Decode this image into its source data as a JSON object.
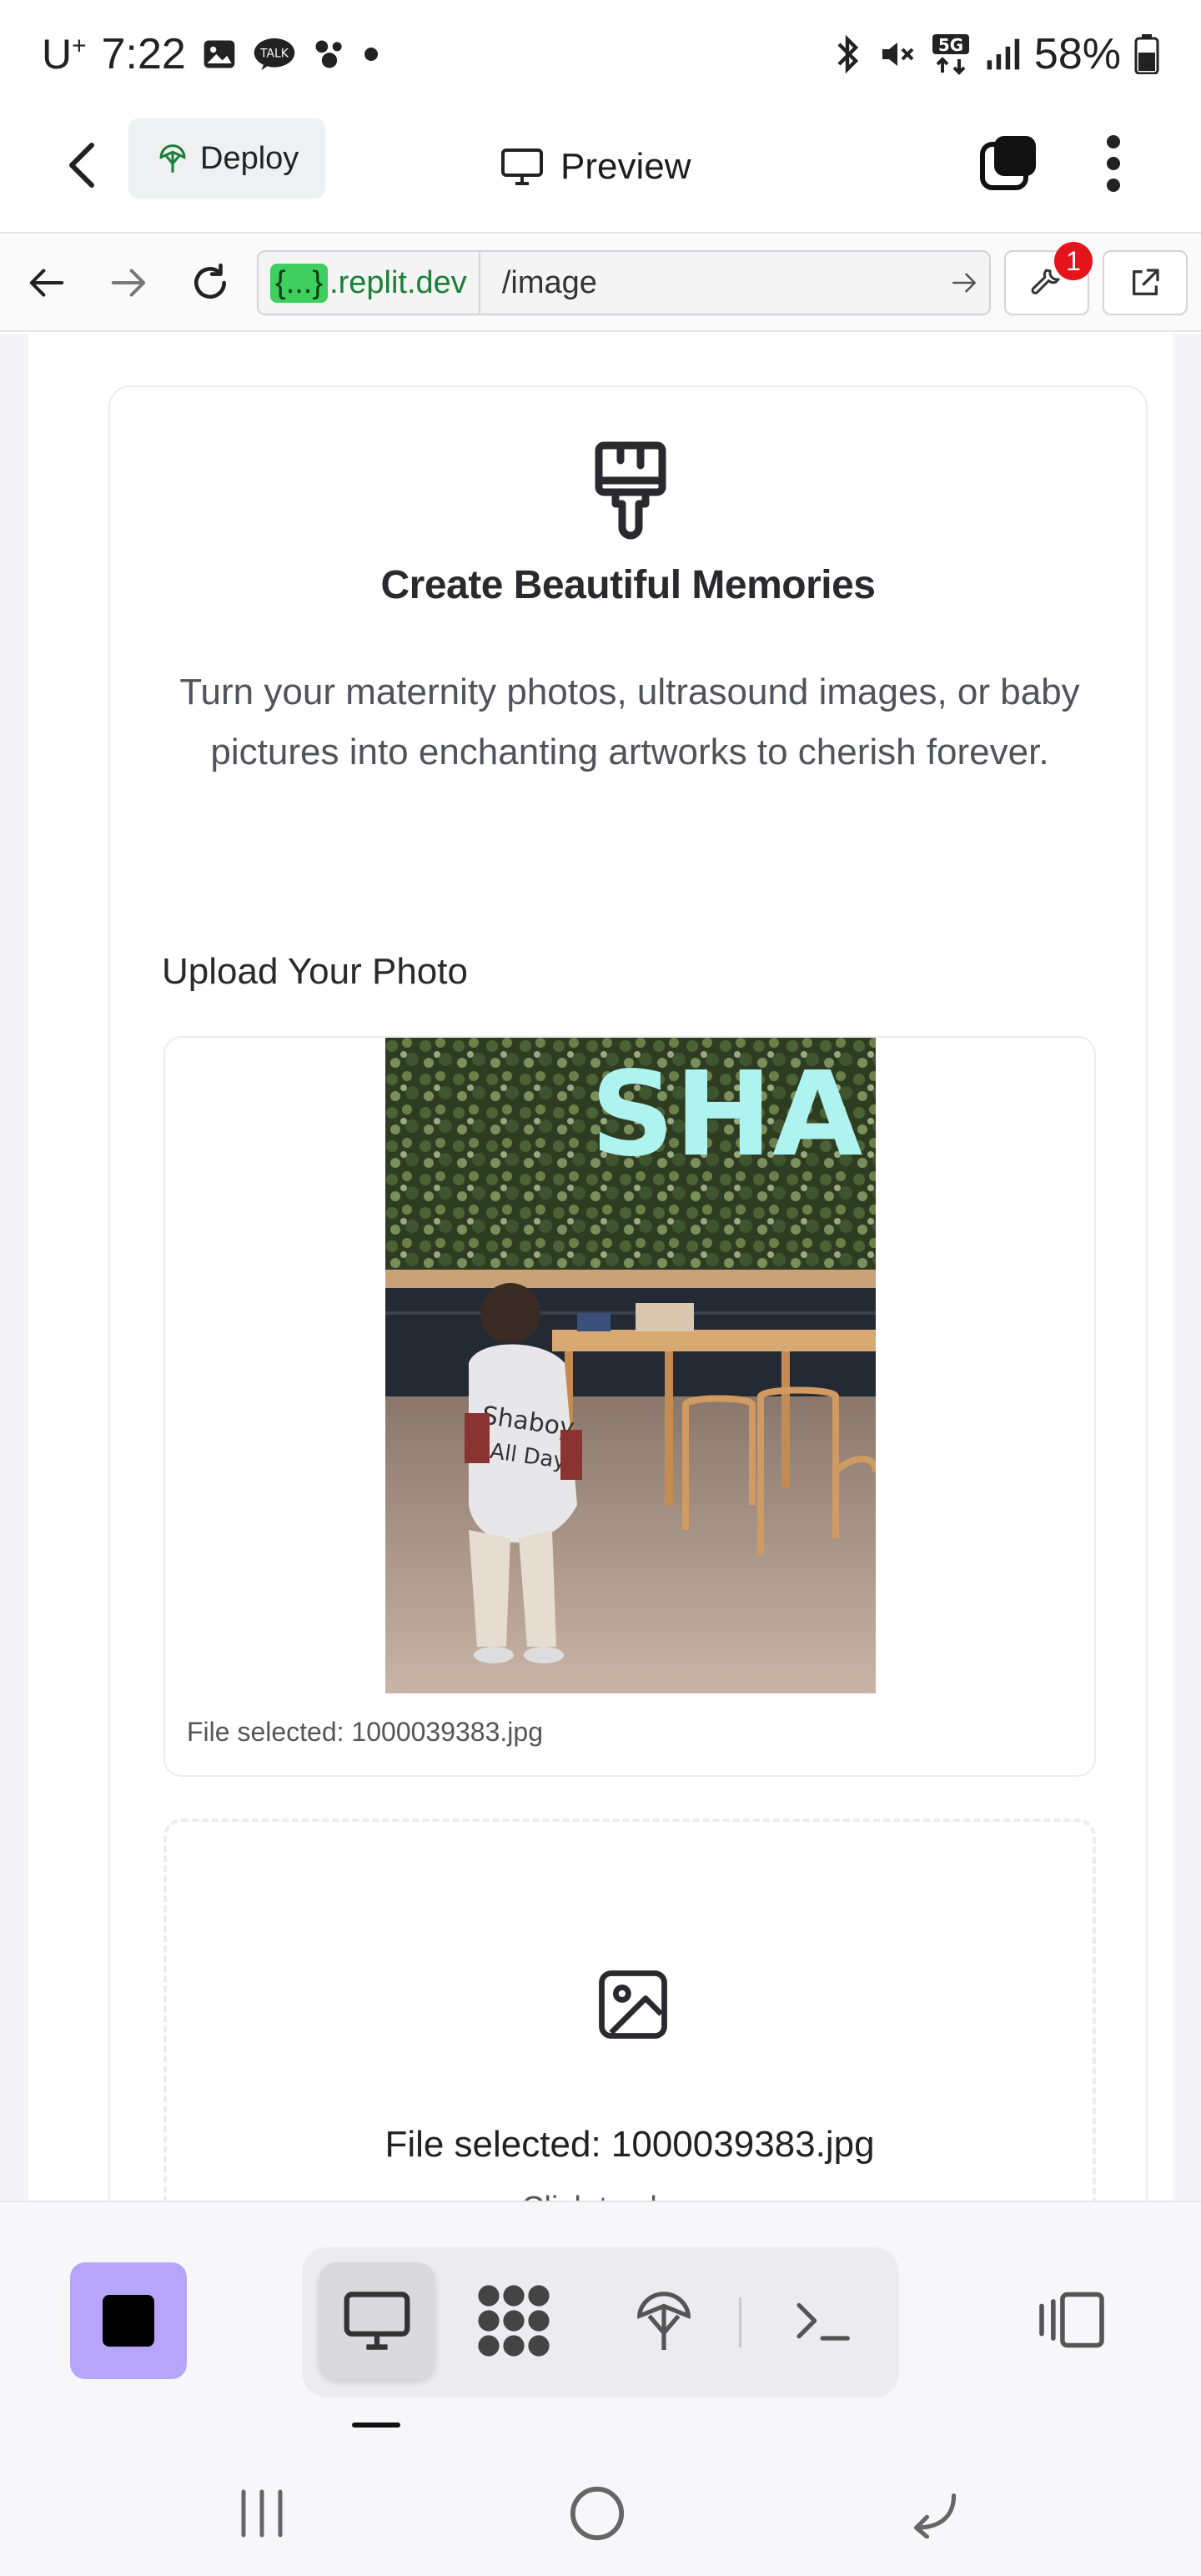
{
  "status_bar": {
    "carrier": "U",
    "carrier_sup": "+",
    "time": "7:22",
    "battery": "58%",
    "notif_icons": [
      "gallery-icon",
      "kakaotalk-icon",
      "kakao-friends-icon",
      "dot-icon"
    ],
    "system_icons": [
      "bluetooth-icon",
      "mute-icon",
      "5g-icon",
      "signal-icon",
      "battery-icon"
    ]
  },
  "app_header": {
    "deploy_label": "Deploy",
    "preview_label": "Preview"
  },
  "browser": {
    "domain_badge": "{...}",
    "domain_suffix": ".replit.dev",
    "path": "/image",
    "devtools_badge_count": "1"
  },
  "card": {
    "title": "Create Beautiful Memories",
    "description": "Turn your maternity photos, ultrasound images, or baby pictures into enchanting artworks to cherish forever.",
    "upload_label": "Upload Your Photo",
    "preview_caption": "File selected: 1000039383.jpg",
    "dropzone_title": "File selected: 1000039383.jpg",
    "dropzone_subtitle": "Click to change"
  },
  "photo": {
    "sign_text": "SHA",
    "shirt_line1": "Shaboy",
    "shirt_line2": "All Day"
  },
  "colors": {
    "accent_purple": "#b6a6fb",
    "url_green": "#1a7f37",
    "badge_red": "#e5141b"
  }
}
